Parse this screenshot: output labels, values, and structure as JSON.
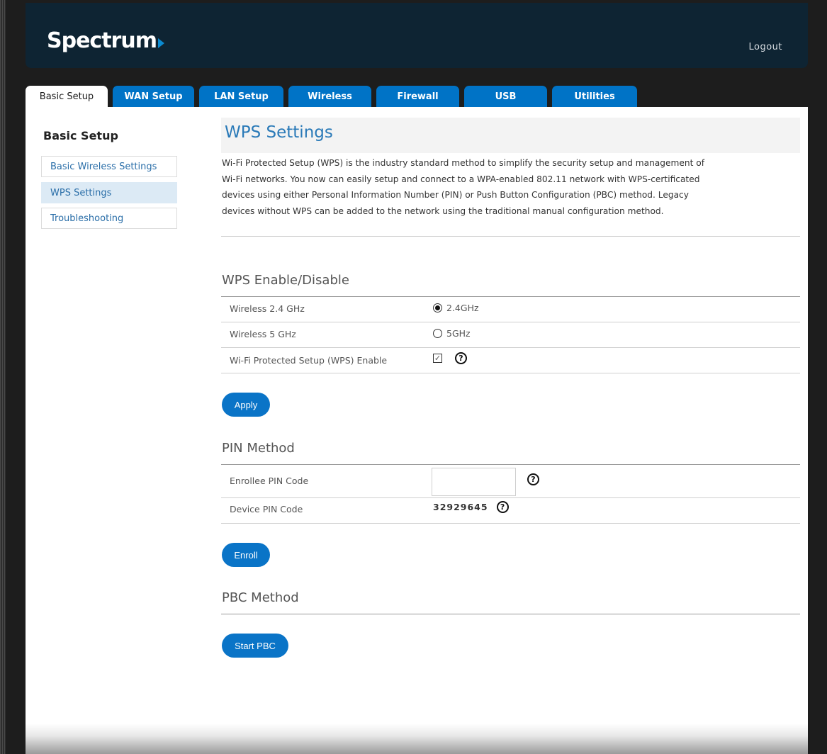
{
  "header": {
    "logo_text": "Spectrum",
    "logout_label": "Logout"
  },
  "tabs": [
    {
      "label": "Basic Setup",
      "active": true
    },
    {
      "label": "WAN Setup"
    },
    {
      "label": "LAN Setup"
    },
    {
      "label": "Wireless"
    },
    {
      "label": "Firewall"
    },
    {
      "label": "USB"
    },
    {
      "label": "Utilities"
    }
  ],
  "sidebar": {
    "title": "Basic Setup",
    "items": [
      {
        "label": "Basic Wireless Settings"
      },
      {
        "label": "WPS Settings",
        "active": true
      },
      {
        "label": "Troubleshooting"
      }
    ]
  },
  "main": {
    "title": "WPS Settings",
    "description_lines": [
      "Wi-Fi Protected Setup (WPS) is the industry standard method to simplify the security setup and management of",
      "Wi-Fi networks. You now can easily setup and connect to a WPA-enabled 802.11 network with WPS-certificated",
      "devices using either Personal Information Number (PIN) or Push Button Configuration (PBC) method. Legacy",
      "devices without WPS can be added to the network using the traditional manual configuration method."
    ],
    "wps_section": {
      "title": "WPS Enable/Disable",
      "rows": [
        {
          "label": "Wireless 2.4 GHz",
          "option": "2.4GHz",
          "selected": true
        },
        {
          "label": "Wireless 5 GHz",
          "option": "5GHz",
          "selected": false
        },
        {
          "label": "Wi-Fi Protected Setup (WPS) Enable",
          "checked": true
        }
      ],
      "apply_label": "Apply"
    },
    "pin_section": {
      "title": "PIN Method",
      "enrollee_label": "Enrollee PIN Code",
      "enrollee_value": "",
      "device_label": "Device PIN Code",
      "device_value": "32929645",
      "enroll_label": "Enroll"
    },
    "pbc_section": {
      "title": "PBC Method",
      "start_label": "Start PBC"
    },
    "help_glyph": "?",
    "check_glyph": "✓"
  },
  "colors": {
    "header_bg": "#0e2433",
    "tab_blue": "#0073c6",
    "button_blue": "#0a74c7",
    "link_blue": "#2a6ea8",
    "title_blue": "#2a7ab8",
    "sidebar_active_bg": "#dceaf5"
  }
}
